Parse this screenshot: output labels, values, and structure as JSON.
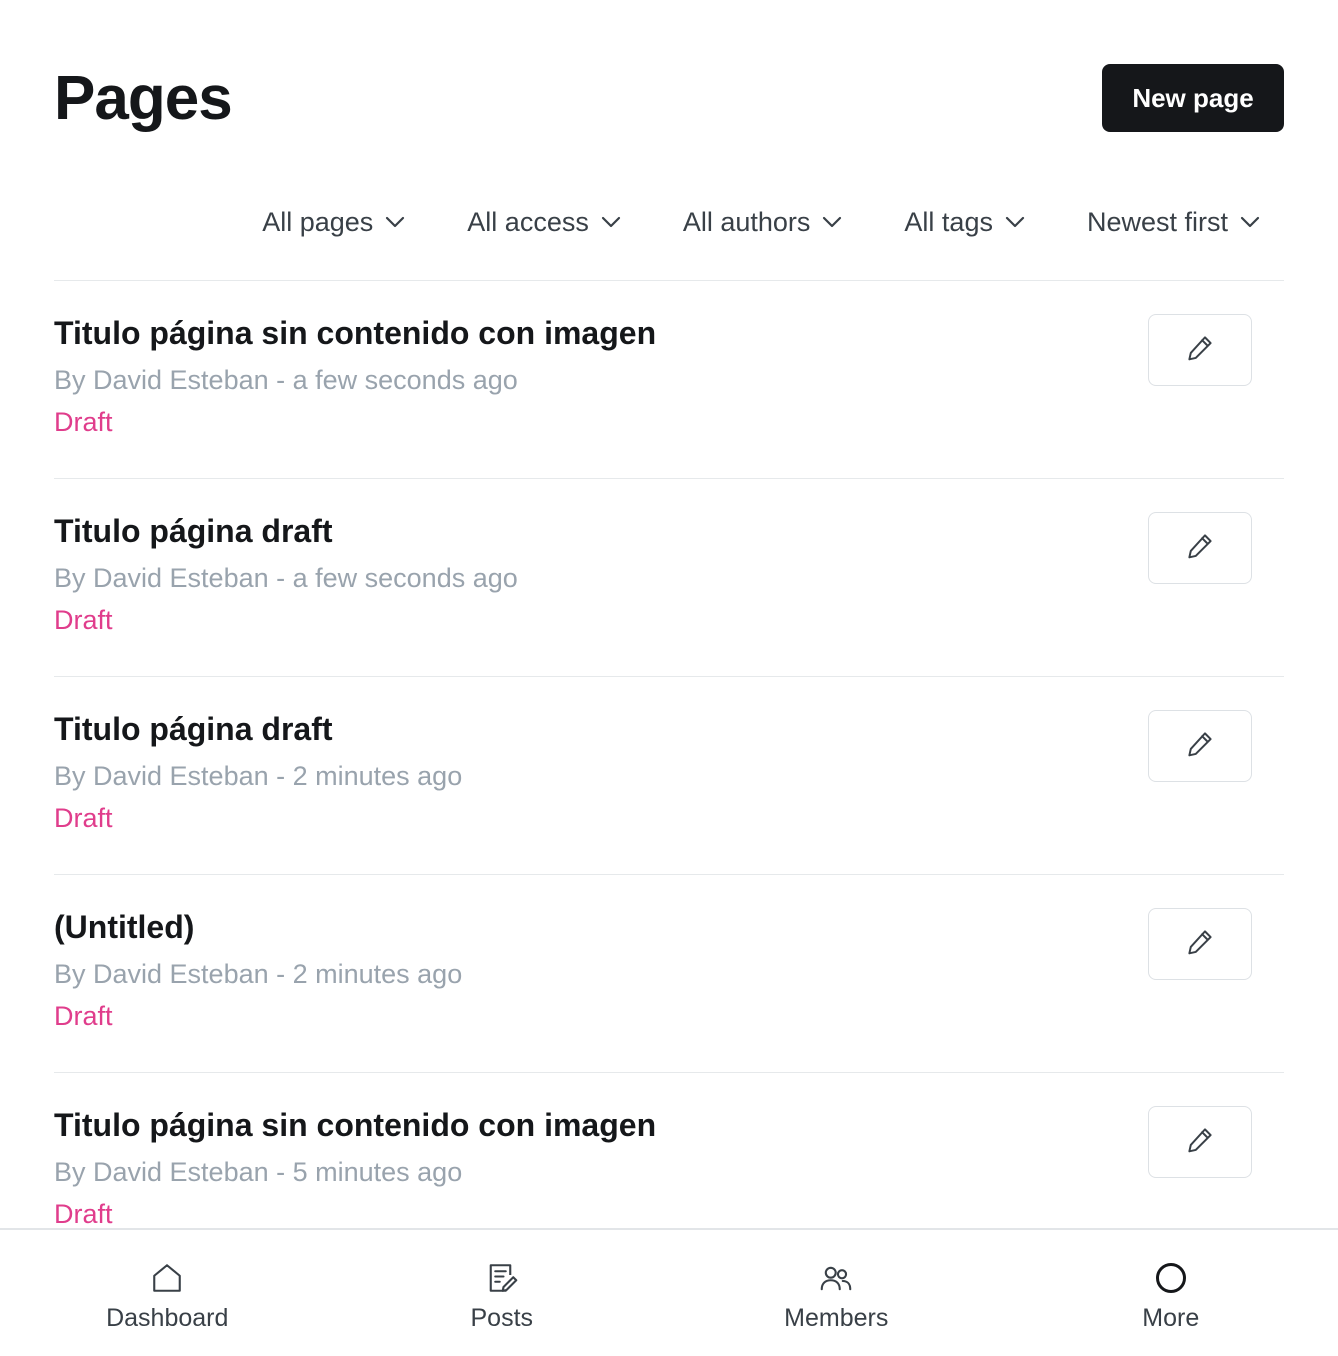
{
  "header": {
    "title": "Pages",
    "new_button": "New page"
  },
  "filters": [
    {
      "label": "All pages"
    },
    {
      "label": "All access"
    },
    {
      "label": "All authors"
    },
    {
      "label": "All tags"
    },
    {
      "label": "Newest first"
    }
  ],
  "pages": [
    {
      "title": "Titulo página sin contenido con imagen",
      "meta": "By David Esteban - a few seconds ago",
      "status": "Draft"
    },
    {
      "title": "Titulo página draft",
      "meta": "By David Esteban - a few seconds ago",
      "status": "Draft"
    },
    {
      "title": "Titulo página draft",
      "meta": "By David Esteban - 2 minutes ago",
      "status": "Draft"
    },
    {
      "title": "(Untitled)",
      "meta": "By David Esteban - 2 minutes ago",
      "status": "Draft"
    },
    {
      "title": "Titulo página sin contenido con imagen",
      "meta": "By David Esteban - 5 minutes ago",
      "status": "Draft"
    }
  ],
  "nav": {
    "dashboard": "Dashboard",
    "posts": "Posts",
    "members": "Members",
    "more": "More"
  },
  "colors": {
    "accent_dark": "#15171a",
    "draft": "#e03d8c",
    "muted": "#99a3ad"
  }
}
